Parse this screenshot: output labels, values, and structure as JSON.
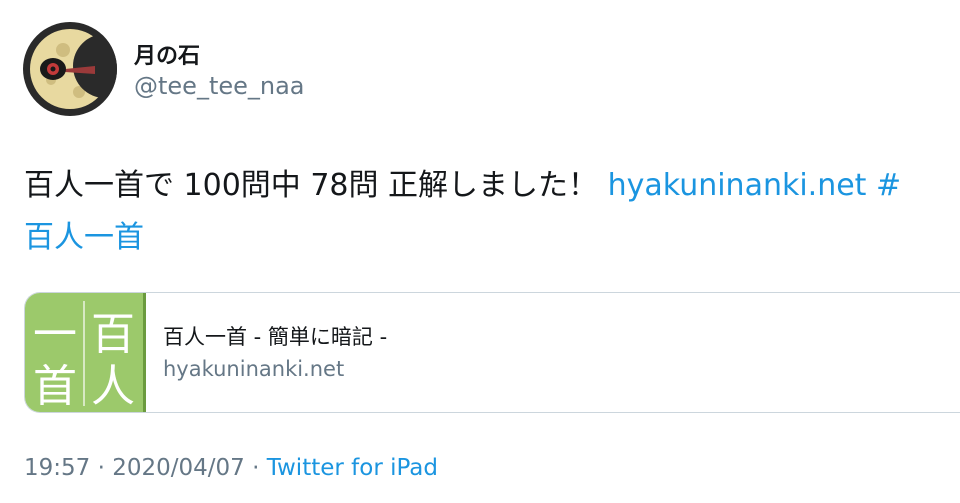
{
  "user": {
    "display_name": "月の石",
    "handle": "@tee_tee_naa",
    "avatar_icon": "lunatone-avatar-icon"
  },
  "tweet": {
    "text_part1": "百人一首で 100問中 78問 正解しました！ ",
    "link": "hyakuninanki.net",
    "hashtag_start": " #",
    "hashtag_text": "百人一首"
  },
  "card": {
    "thumb_chars": [
      "一",
      "百",
      "首",
      "人"
    ],
    "title": "百人一首 - 簡単に暗記 -",
    "domain": "hyakuninanki.net",
    "thumb_color": "#9cc96b"
  },
  "meta": {
    "time": "19:57",
    "separator": " · ",
    "date": "2020/04/07",
    "source": "Twitter for iPad"
  },
  "colors": {
    "link": "#1b95e0",
    "secondary_text": "#657786",
    "primary_text": "#14171a"
  }
}
